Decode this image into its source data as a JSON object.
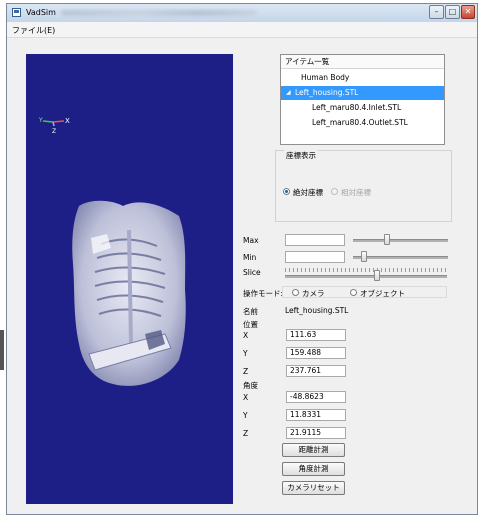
{
  "window": {
    "title": "VadSim",
    "buttons": [
      "–",
      "□",
      "✕"
    ]
  },
  "menu": {
    "items": [
      "ファイル(E)"
    ]
  },
  "viewport": {
    "axis_labels": {
      "y": "Y",
      "x": "X",
      "z": "Z"
    }
  },
  "item_list": {
    "header": "アイテム一覧",
    "items": [
      {
        "label": "Human Body",
        "level": 0,
        "selected": false,
        "expanded": null
      },
      {
        "label": "Left_housing.STL",
        "level": 0,
        "selected": true,
        "expanded": true
      },
      {
        "label": "Left_maru80.4.Inlet.STL",
        "level": 1,
        "selected": false,
        "expanded": null
      },
      {
        "label": "Left_maru80.4.Outlet.STL",
        "level": 1,
        "selected": false,
        "expanded": null
      }
    ]
  },
  "coords_display": {
    "group_title": "座標表示",
    "options": [
      {
        "label": "絶対座標",
        "checked": true,
        "enabled": true
      },
      {
        "label": "相対座標",
        "checked": false,
        "enabled": false
      }
    ]
  },
  "sliders": {
    "max_label": "Max",
    "max_value": "",
    "max_level": 0.36,
    "min_label": "Min",
    "min_value": "",
    "min_level": 0.12,
    "slice_label": "Slice",
    "slice_level": 0.57
  },
  "operation_mode": {
    "label": "操作モード:",
    "options": [
      {
        "label": "カメラ",
        "checked": false
      },
      {
        "label": "オブジェクト",
        "checked": false
      }
    ]
  },
  "object": {
    "name_label": "名前",
    "name_value": "Left_housing.STL",
    "position_label": "位置",
    "position": [
      {
        "axis": "X",
        "value": "111.63"
      },
      {
        "axis": "Y",
        "value": "159.488"
      },
      {
        "axis": "Z",
        "value": "237.761"
      }
    ],
    "angle_label": "角度",
    "angle": [
      {
        "axis": "X",
        "value": "-48.8623"
      },
      {
        "axis": "Y",
        "value": "11.8331"
      },
      {
        "axis": "Z",
        "value": "21.9115"
      }
    ]
  },
  "buttons": {
    "distance": "距離計測",
    "angle": "角度計測",
    "camera_reset": "カメラリセット"
  },
  "colors": {
    "viewport_bg": "#1e1f86",
    "selection": "#3399ff"
  }
}
